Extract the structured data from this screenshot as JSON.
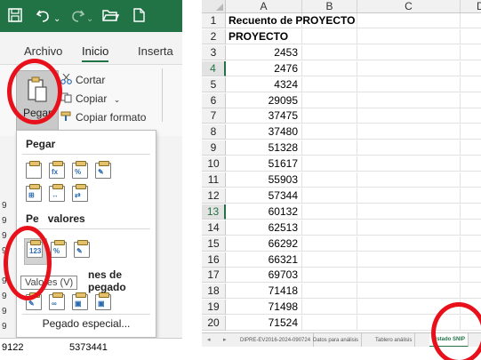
{
  "left": {
    "title_icons": [
      "save-icon",
      "undo-icon",
      "redo-icon",
      "open-folder-icon",
      "new-doc-icon"
    ],
    "ribbon_tabs": [
      "Archivo",
      "Inicio",
      "Inserta"
    ],
    "paste_label": "Pegar",
    "clipboard": {
      "cut": "Cortar",
      "copy": "Copiar",
      "format_painter": "Copiar formato"
    },
    "menu": {
      "section_paste": "Pegar",
      "section_values": "Pegar valores",
      "section_other": "Otras opciones de pegado",
      "section_other_visible": "nes de pegado",
      "section_values_visible": "valores",
      "section_values_prefix": "Pe",
      "tooltip": "Valores (V)",
      "special": "Pegado especial..."
    },
    "under_menu_rows": [
      "9",
      "9",
      "9",
      "9",
      "9",
      "9",
      "9",
      "9"
    ],
    "bottom_row": {
      "row": "9122",
      "value": "5373441"
    }
  },
  "sheet": {
    "columns": [
      "A",
      "B",
      "C",
      "D"
    ],
    "rows": [
      {
        "n": "1",
        "a": "Recuento de PROYECTO",
        "bold": true
      },
      {
        "n": "2",
        "a": "PROYECTO",
        "bold": true
      },
      {
        "n": "3",
        "a": "2453"
      },
      {
        "n": "4",
        "a": "2476"
      },
      {
        "n": "5",
        "a": "4324"
      },
      {
        "n": "6",
        "a": "29095"
      },
      {
        "n": "7",
        "a": "37475"
      },
      {
        "n": "8",
        "a": "37480"
      },
      {
        "n": "9",
        "a": "51328"
      },
      {
        "n": "10",
        "a": "51617"
      },
      {
        "n": "11",
        "a": "55903"
      },
      {
        "n": "12",
        "a": "57344"
      },
      {
        "n": "13",
        "a": "60132"
      },
      {
        "n": "14",
        "a": "62513"
      },
      {
        "n": "15",
        "a": "66292"
      },
      {
        "n": "16",
        "a": "66321"
      },
      {
        "n": "17",
        "a": "69703"
      },
      {
        "n": "18",
        "a": "71418"
      },
      {
        "n": "19",
        "a": "71498"
      },
      {
        "n": "20",
        "a": "71524"
      }
    ],
    "sheet_tabs": [
      "DIPRE-EV2016-2024-090724",
      "Datos para análisis",
      "Tablero análisis",
      "Listado SNIP"
    ],
    "active_tab": "Listado SNIP"
  },
  "colors": {
    "excel_green": "#217346",
    "highlight_ring": "#e8101a"
  }
}
